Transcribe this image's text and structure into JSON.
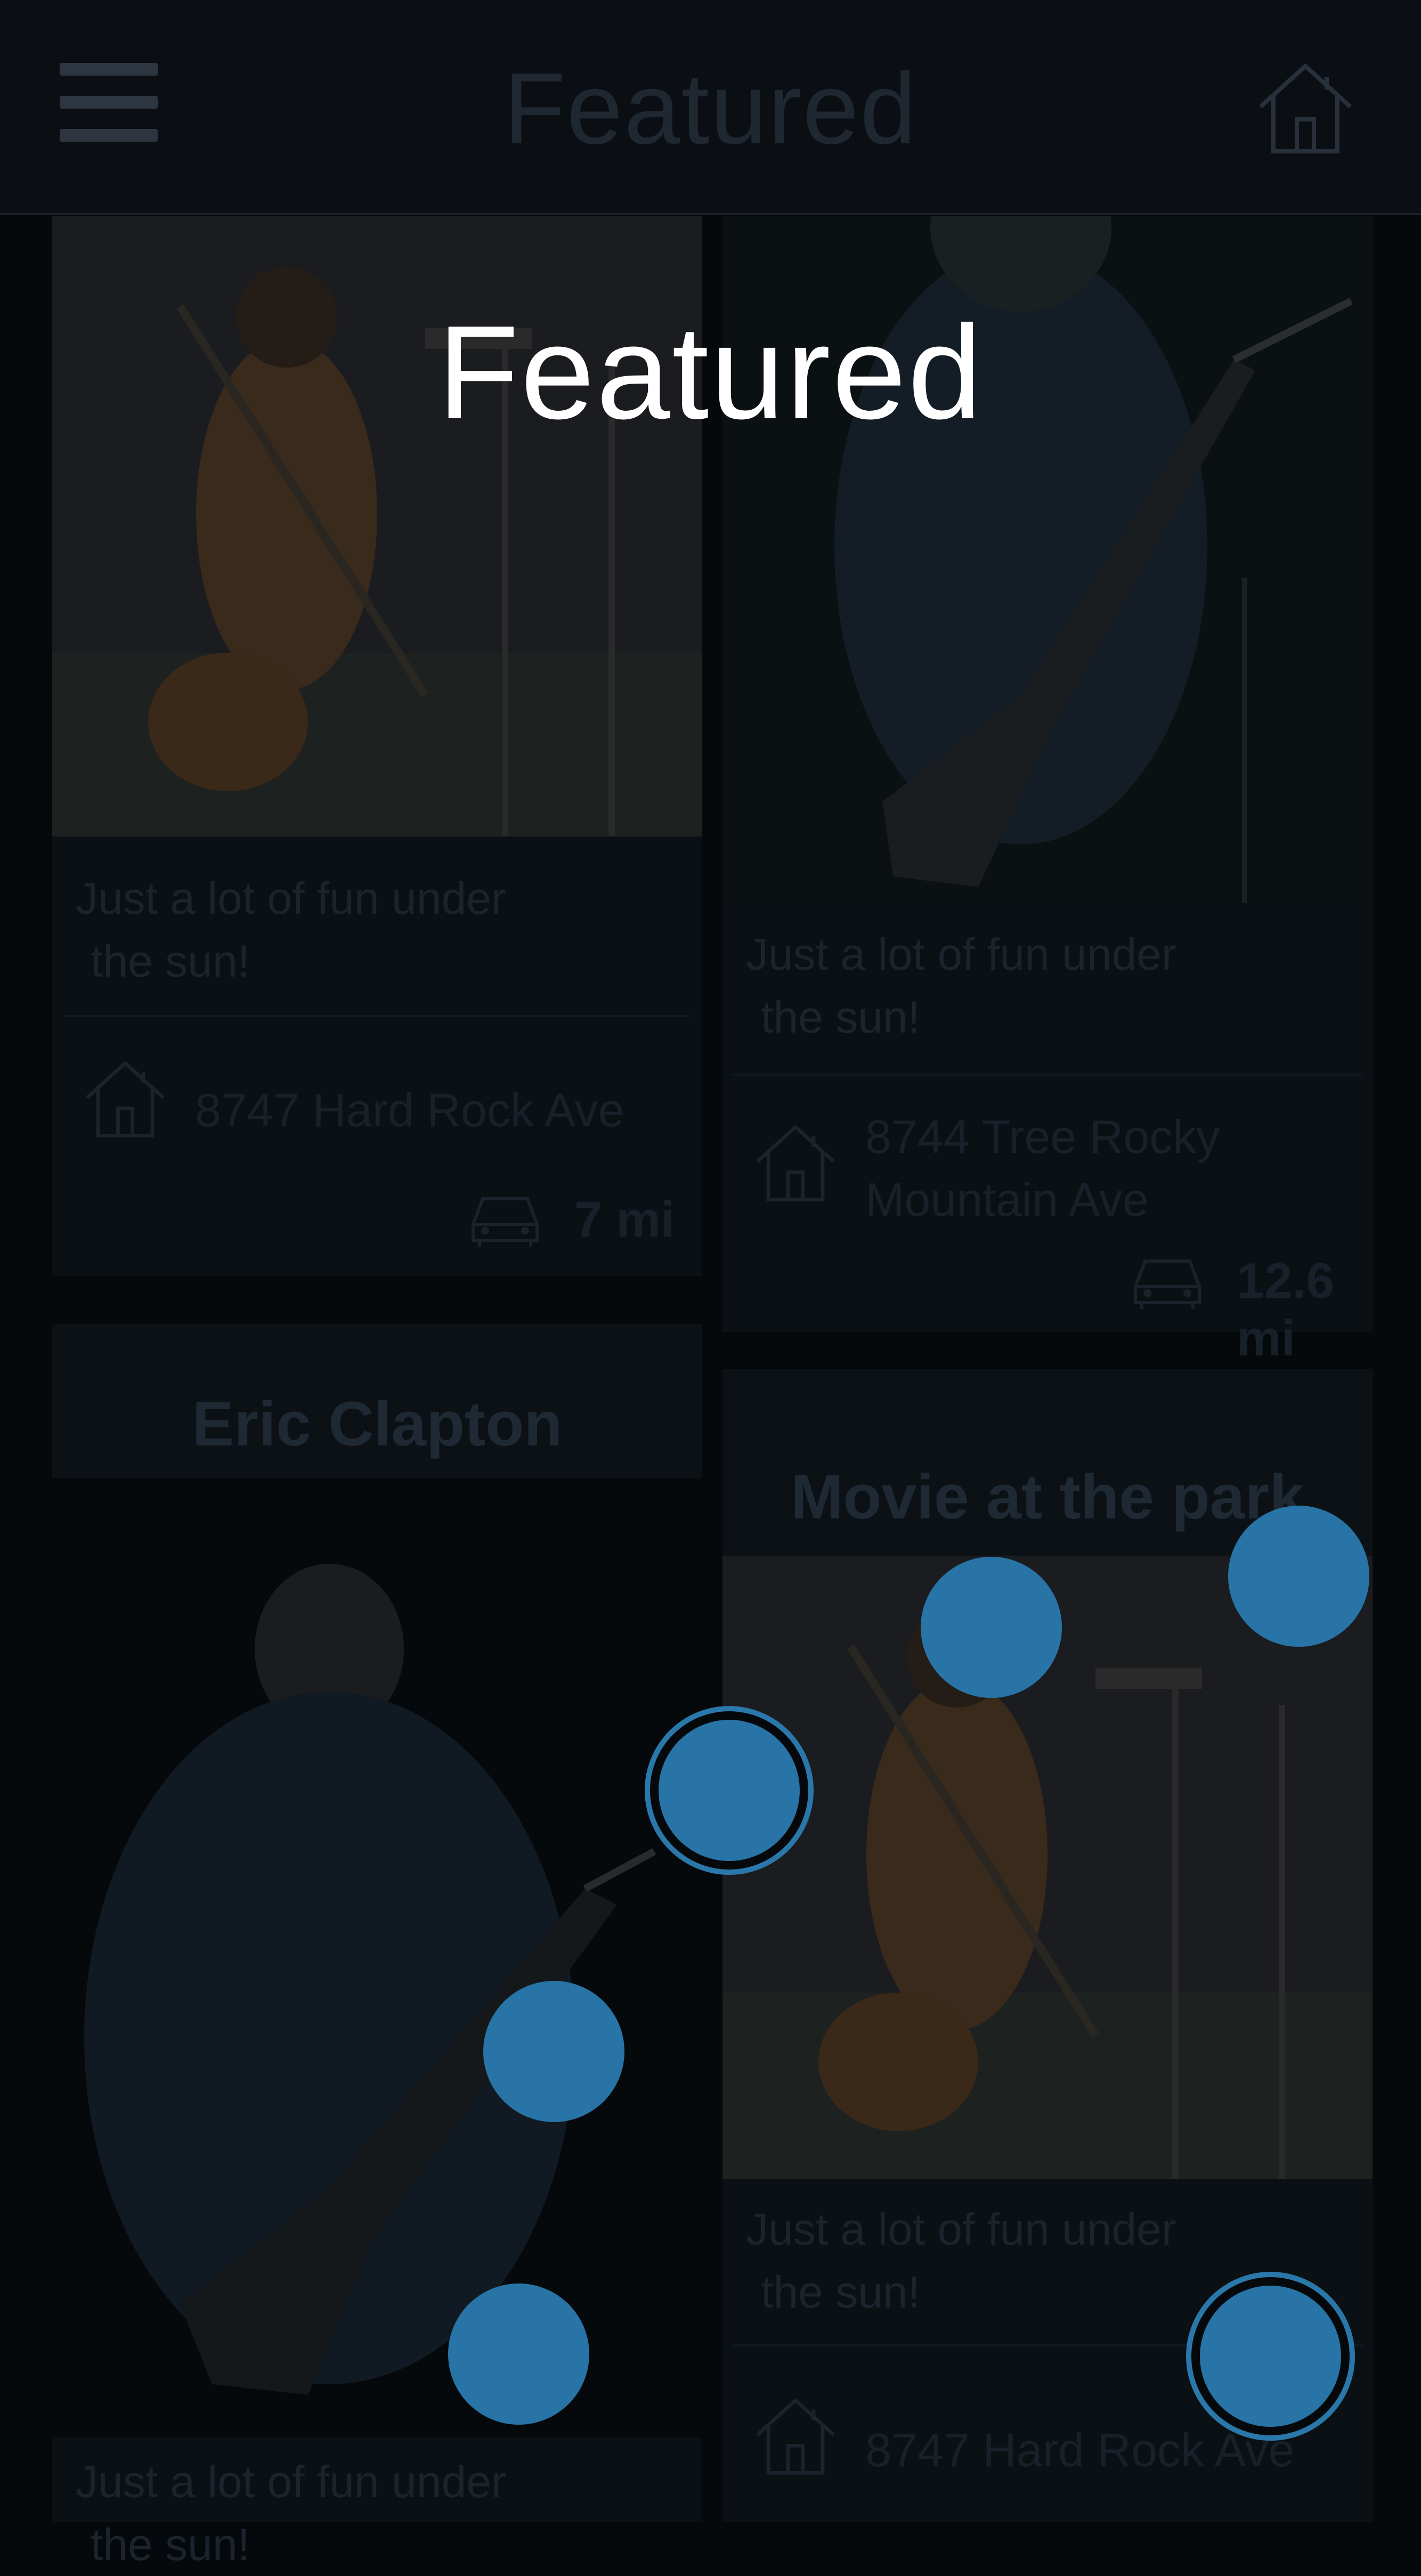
{
  "header": {
    "title": "Featured",
    "menu_icon": "hamburger-menu-icon",
    "home_icon": "home-icon"
  },
  "overlay": {
    "title": "Featured",
    "dot_color": "#2874a6"
  },
  "cards": [
    {
      "desc_line1": "Just a lot of fun under",
      "desc_line2": "the sun!",
      "address_line1": "8747 Hard Rock Ave",
      "distance": "7 mi"
    },
    {
      "desc_line1": "Just a lot of fun under",
      "desc_line2": "the sun!",
      "address_line1": "8744 Tree Rocky",
      "address_line2": "Mountain Ave",
      "distance": "12.6 mi"
    },
    {
      "title": "Eric Clapton",
      "desc_line1": "Just a lot of fun under",
      "desc_line2": "the sun!"
    },
    {
      "title": "Movie at the park",
      "desc_line1": "Just a lot of fun under",
      "desc_line2": "the sun!",
      "address_line1": "8747 Hard Rock Ave"
    }
  ]
}
